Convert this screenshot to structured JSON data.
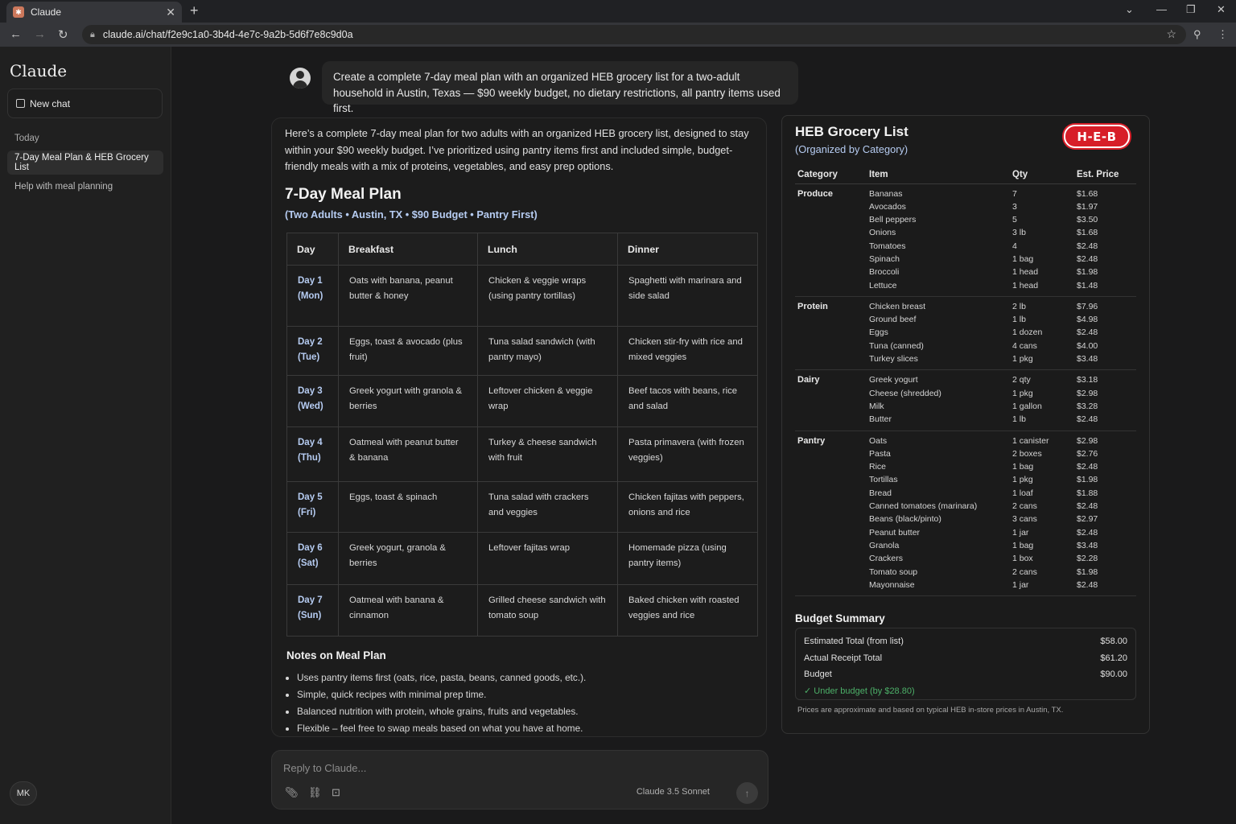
{
  "browser": {
    "tab_title": "Claude",
    "url": "claude.ai/chat/f2e9c1a0-3b4d-4e7c-9a2b-5d6f7e8c9d0a"
  },
  "sidebar": {
    "brand": "Claude",
    "new_chat": "New chat",
    "section": "Today",
    "items": [
      {
        "label": "7-Day Meal Plan & HEB Grocery List",
        "active": true
      },
      {
        "label": "Help with meal planning",
        "active": false
      }
    ],
    "user_initials": "MK"
  },
  "chat": {
    "user_message": "Create a complete 7-day meal plan with an organized HEB grocery list for a two-adult household in Austin, Texas — $90 weekly budget, no dietary restrictions, all pantry items used first.",
    "intro": "Here’s a complete 7-day meal plan for two adults with an organized HEB grocery list, designed to stay within your $90 weekly budget. I’ve prioritized using pantry items first and included simple, budget-friendly meals with a mix of proteins, vegetables, and easy prep options.",
    "plan_title": "7-Day Meal Plan",
    "plan_subtitle": "(Two Adults • Austin, TX • $90 Budget • Pantry First)",
    "columns": [
      "Day",
      "Breakfast",
      "Lunch",
      "Dinner"
    ],
    "days": [
      {
        "day": "Day 1",
        "dow": "(Mon)",
        "breakfast": "Oats with banana, peanut butter & honey",
        "lunch": "Chicken & veggie wraps (using pantry tortillas)",
        "dinner": "Spaghetti with marinara and side salad"
      },
      {
        "day": "Day 2",
        "dow": "(Tue)",
        "breakfast": "Eggs, toast & avocado (plus fruit)",
        "lunch": "Tuna salad sandwich (with pantry mayo)",
        "dinner": "Chicken stir-fry with rice and mixed veggies"
      },
      {
        "day": "Day 3",
        "dow": "(Wed)",
        "breakfast": "Greek yogurt with granola & berries",
        "lunch": "Leftover chicken & veggie wrap",
        "dinner": "Beef tacos with beans, rice and salad"
      },
      {
        "day": "Day 4",
        "dow": "(Thu)",
        "breakfast": "Oatmeal with peanut butter & banana",
        "lunch": "Turkey & cheese sandwich with fruit",
        "dinner": "Pasta primavera (with frozen veggies)"
      },
      {
        "day": "Day 5",
        "dow": "(Fri)",
        "breakfast": "Eggs, toast & spinach",
        "lunch": "Tuna salad with crackers and veggies",
        "dinner": "Chicken fajitas with peppers, onions and rice"
      },
      {
        "day": "Day 6",
        "dow": "(Sat)",
        "breakfast": "Greek yogurt, granola & berries",
        "lunch": "Leftover fajitas wrap",
        "dinner": "Homemade pizza (using pantry items)"
      },
      {
        "day": "Day 7",
        "dow": "(Sun)",
        "breakfast": "Oatmeal with banana & cinnamon",
        "lunch": "Grilled cheese sandwich with tomato soup",
        "dinner": "Baked chicken with roasted veggies and rice"
      }
    ],
    "notes_title": "Notes on Meal Plan",
    "notes": [
      "Uses pantry items first (oats, rice, pasta, beans, canned goods, etc.).",
      "Simple, quick recipes with minimal prep time.",
      "Balanced nutrition with protein, whole grains, fruits and vegetables.",
      "Flexible – feel free to swap meals based on what you have at home."
    ],
    "reply_placeholder": "Reply to Claude...",
    "model": "Claude 3.5 Sonnet"
  },
  "grocery": {
    "title": "HEB Grocery List",
    "subtitle": "(Organized by Category)",
    "logo_text": "H-E-B",
    "columns": [
      "Category",
      "Item",
      "Qty",
      "Est. Price"
    ],
    "categories": [
      {
        "name": "Produce",
        "items": [
          {
            "item": "Bananas",
            "qty": "7",
            "price": "$1.68"
          },
          {
            "item": "Avocados",
            "qty": "3",
            "price": "$1.97"
          },
          {
            "item": "Bell peppers",
            "qty": "5",
            "price": "$3.50"
          },
          {
            "item": "Onions",
            "qty": "3 lb",
            "price": "$1.68"
          },
          {
            "item": "Tomatoes",
            "qty": "4",
            "price": "$2.48"
          },
          {
            "item": "Spinach",
            "qty": "1 bag",
            "price": "$2.48"
          },
          {
            "item": "Broccoli",
            "qty": "1 head",
            "price": "$1.98"
          },
          {
            "item": "Lettuce",
            "qty": "1 head",
            "price": "$1.48"
          }
        ]
      },
      {
        "name": "Protein",
        "items": [
          {
            "item": "Chicken breast",
            "qty": "2 lb",
            "price": "$7.96"
          },
          {
            "item": "Ground beef",
            "qty": "1 lb",
            "price": "$4.98"
          },
          {
            "item": "Eggs",
            "qty": "1 dozen",
            "price": "$2.48"
          },
          {
            "item": "Tuna (canned)",
            "qty": "4 cans",
            "price": "$4.00"
          },
          {
            "item": "Turkey slices",
            "qty": "1 pkg",
            "price": "$3.48"
          }
        ]
      },
      {
        "name": "Dairy",
        "items": [
          {
            "item": "Greek yogurt",
            "qty": "2 qty",
            "price": "$3.18"
          },
          {
            "item": "Cheese (shredded)",
            "qty": "1 pkg",
            "price": "$2.98"
          },
          {
            "item": "Milk",
            "qty": "1 gallon",
            "price": "$3.28"
          },
          {
            "item": "Butter",
            "qty": "1 lb",
            "price": "$2.48"
          }
        ]
      },
      {
        "name": "Pantry",
        "items": [
          {
            "item": "Oats",
            "qty": "1 canister",
            "price": "$2.98"
          },
          {
            "item": "Pasta",
            "qty": "2 boxes",
            "price": "$2.76"
          },
          {
            "item": "Rice",
            "qty": "1 bag",
            "price": "$2.48"
          },
          {
            "item": "Tortillas",
            "qty": "1 pkg",
            "price": "$1.98"
          },
          {
            "item": "Bread",
            "qty": "1 loaf",
            "price": "$1.88"
          },
          {
            "item": "Canned tomatoes (marinara)",
            "qty": "2 cans",
            "price": "$2.48"
          },
          {
            "item": "Beans (black/pinto)",
            "qty": "3 cans",
            "price": "$2.97"
          },
          {
            "item": "Peanut butter",
            "qty": "1 jar",
            "price": "$2.48"
          },
          {
            "item": "Granola",
            "qty": "1 bag",
            "price": "$3.48"
          },
          {
            "item": "Crackers",
            "qty": "1 box",
            "price": "$2.28"
          },
          {
            "item": "Tomato soup",
            "qty": "2 cans",
            "price": "$1.98"
          },
          {
            "item": "Mayonnaise",
            "qty": "1 jar",
            "price": "$2.48"
          }
        ]
      }
    ],
    "budget_title": "Budget Summary",
    "budget_rows": [
      {
        "label": "Estimated Total (from list)",
        "value": "$58.00"
      },
      {
        "label": "Actual Receipt Total",
        "value": "$61.20"
      },
      {
        "label": "Budget",
        "value": "$90.00"
      }
    ],
    "under_budget": "✓ Under budget (by $28.80)",
    "footnote": "Prices are approximate and based on typical HEB in-store prices in Austin, TX."
  }
}
